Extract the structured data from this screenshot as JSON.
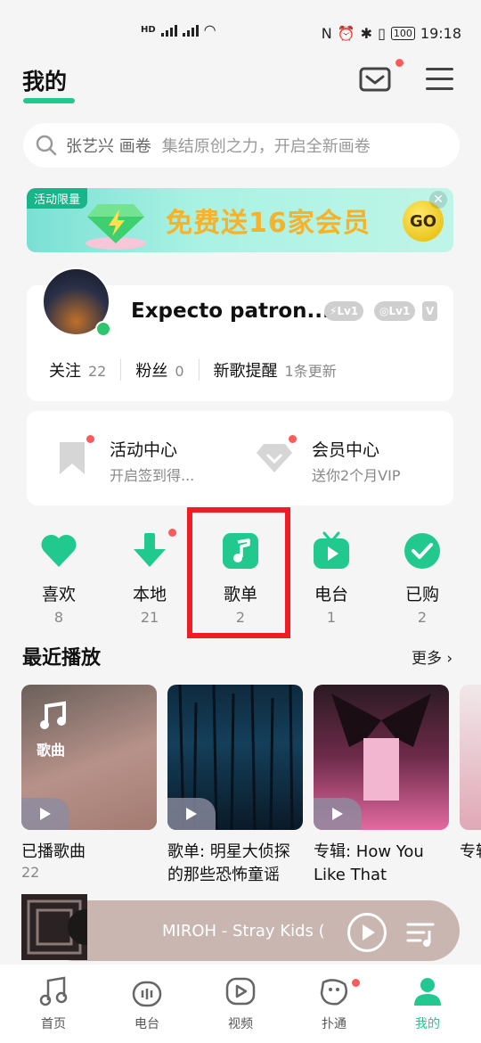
{
  "status_bar": {
    "left_text": "HD 1 HD 2 4G 4G",
    "time": "19:18",
    "battery": "100"
  },
  "header": {
    "title": "我的"
  },
  "search": {
    "hint_primary": "张艺兴 画卷",
    "hint_secondary": "集结原创之力，开启全新画卷"
  },
  "banner": {
    "tag": "活动限量",
    "text": "免费送16家会员",
    "go": "GO"
  },
  "profile": {
    "username": "Expecto patron...",
    "level_badges": [
      "Lv1",
      "Lv1"
    ],
    "stats": [
      {
        "label": "关注",
        "value": "22"
      },
      {
        "label": "粉丝",
        "value": "0"
      },
      {
        "label": "新歌提醒",
        "value": "1条更新"
      }
    ]
  },
  "activity": [
    {
      "title": "活动中心",
      "subtitle": "开启签到得..."
    },
    {
      "title": "会员中心",
      "subtitle": "送你2个月VIP"
    }
  ],
  "shortcuts": [
    {
      "label": "喜欢",
      "count": "8",
      "icon": "heart-icon"
    },
    {
      "label": "本地",
      "count": "21",
      "icon": "download-icon"
    },
    {
      "label": "歌单",
      "count": "2",
      "icon": "music-note-icon"
    },
    {
      "label": "电台",
      "count": "1",
      "icon": "radio-tv-icon"
    },
    {
      "label": "已购",
      "count": "2",
      "icon": "check-circle-icon"
    }
  ],
  "recent": {
    "title": "最近播放",
    "more": "更多",
    "items": [
      {
        "title": "已播歌曲",
        "count": "22",
        "cover_label": "歌曲"
      },
      {
        "title": "歌单: 明星大侦探的那些恐怖童谣"
      },
      {
        "title": "专辑: How You Like That"
      },
      {
        "title": "专辑 wit"
      }
    ]
  },
  "player": {
    "title": "MIROH - Stray Kids ("
  },
  "nav": [
    {
      "label": "首页",
      "icon": "music-note-icon"
    },
    {
      "label": "电台",
      "icon": "radio-icon"
    },
    {
      "label": "视频",
      "icon": "video-play-icon"
    },
    {
      "label": "扑通",
      "icon": "social-icon"
    },
    {
      "label": "我的",
      "icon": "user-icon"
    }
  ],
  "colors": {
    "accent": "#21c98f",
    "highlight": "#ee1c24",
    "badge_dot": "#ff5a5a"
  }
}
